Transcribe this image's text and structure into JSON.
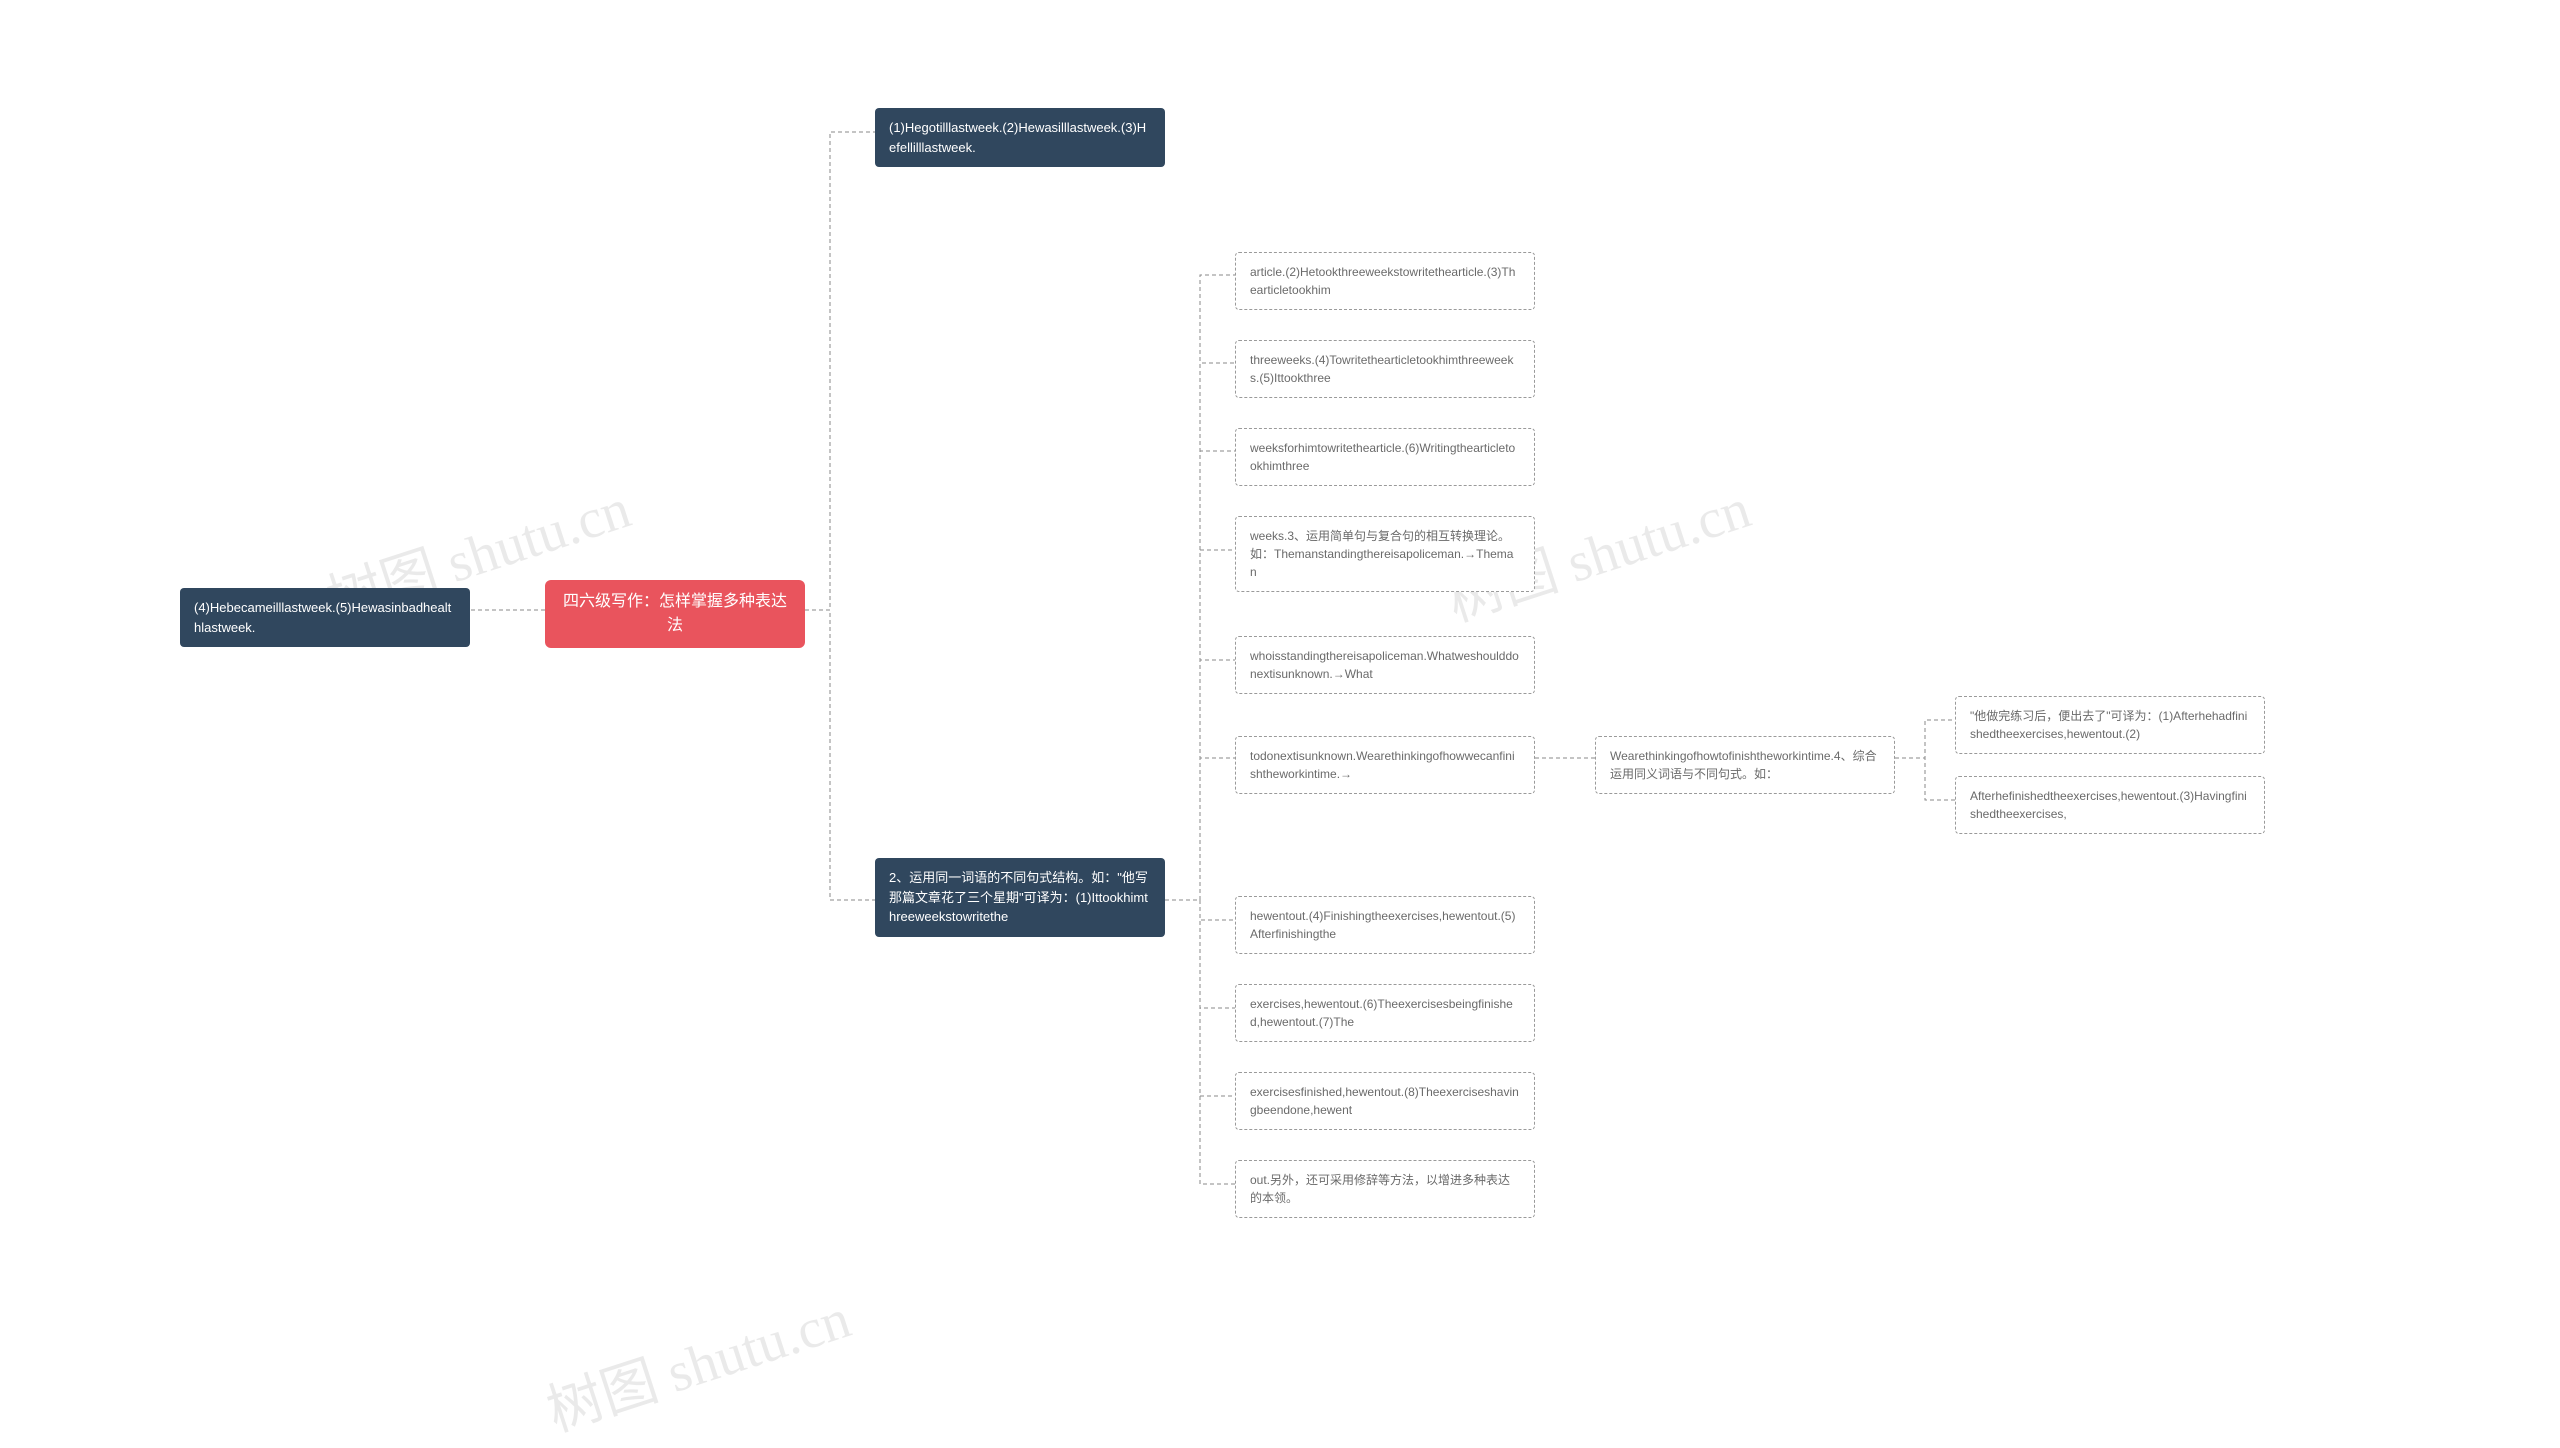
{
  "watermark": "树图 shutu.cn",
  "root": {
    "text": "四六级写作：怎样掌握多种表达法"
  },
  "left_child": {
    "text": "(4)Hebecameilllastweek.(5)Hewasinbadhealthlastweek."
  },
  "right_children": {
    "top": {
      "text": "(1)Hegotilllastweek.(2)Hewasilllastweek.(3)Hefellilllastweek."
    },
    "bottom": {
      "text": "2、运用同一词语的不同句式结构。如：\"他写那篇文章花了三个星期\"可译为：(1)Ittookhimthreeweekstowritethe",
      "children": [
        {
          "text": "article.(2)Hetookthreeweekstowritethearticle.(3)Thearticletookhim"
        },
        {
          "text": "threeweeks.(4)Towritethearticletookhimthreeweeks.(5)Ittookthree"
        },
        {
          "text": "weeksforhimtowritethearticle.(6)Writingthearticletookhimthree"
        },
        {
          "text": "weeks.3、运用简单句与复合句的相互转换理论。如：Themanstandingthereisapoliceman.→Theman"
        },
        {
          "text": "whoisstandingthereisapoliceman.Whatweshoulddonextisunknown.→What"
        },
        {
          "text": "todonextisunknown.Wearethinkingofhowwecanfinishtheworkintime.→",
          "child": {
            "text": "Wearethinkingofhowtofinishtheworkintime.4、综合运用同义词语与不同句式。如：",
            "children": [
              {
                "text": "\"他做完练习后，便出去了\"可译为：(1)Afterhehadfinishedtheexercises,hewentout.(2)"
              },
              {
                "text": "Afterhefinishedtheexercises,hewentout.(3)Havingfinishedtheexercises,"
              }
            ]
          }
        },
        {
          "text": "hewentout.(4)Finishingtheexercises,hewentout.(5)Afterfinishingthe"
        },
        {
          "text": "exercises,hewentout.(6)Theexercisesbeingfinished,hewentout.(7)The"
        },
        {
          "text": "exercisesfinished,hewentout.(8)Theexerciseshavingbeendone,hewent"
        },
        {
          "text": "out.另外，还可采用修辞等方法，以增进多种表达的本领。"
        }
      ]
    }
  }
}
